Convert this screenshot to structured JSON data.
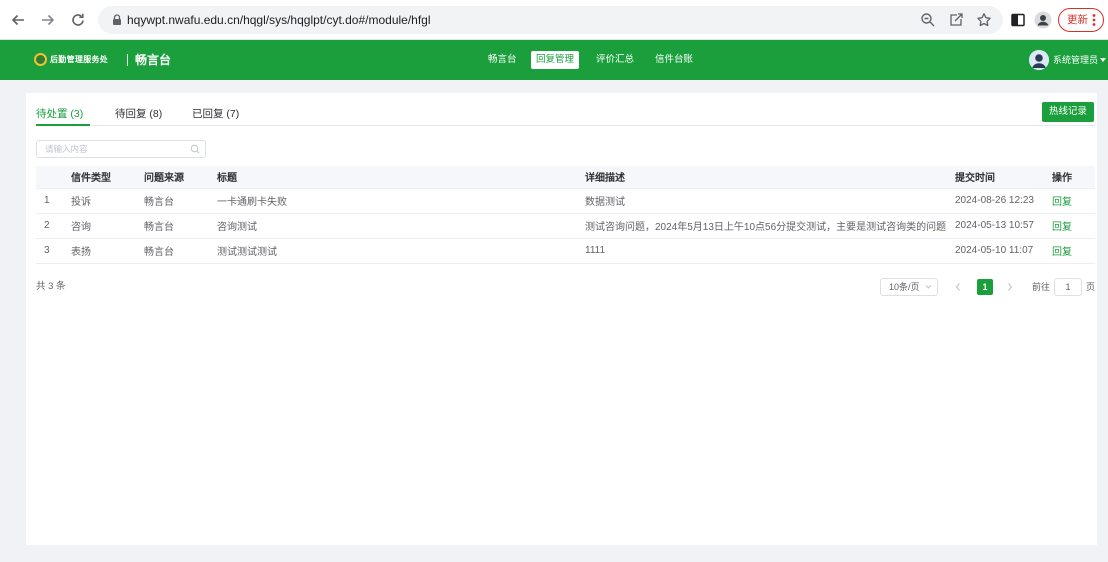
{
  "browser": {
    "url": "hqywpt.nwafu.edu.cn/hqgl/sys/hqglpt/cyt.do#/module/hfgl",
    "update_label": "更新",
    "icons": [
      "back-arrow-icon",
      "forward-arrow-icon",
      "reload-icon",
      "lock-icon",
      "zoom-icon",
      "share-icon",
      "bookmark-star-icon",
      "sidebar-icon",
      "profile-icon",
      "more-menu-icon"
    ]
  },
  "header": {
    "org_name": "后勤管理服务处",
    "app_name": "畅言台",
    "nav": [
      {
        "label": "畅言台",
        "active": false
      },
      {
        "label": "回复管理",
        "active": true
      },
      {
        "label": "评价汇总",
        "active": false
      },
      {
        "label": "信件台账",
        "active": false
      }
    ],
    "user_name": "系统管理员",
    "icons": [
      "emblem-logo",
      "user-avatar-icon",
      "caret-down-icon"
    ]
  },
  "tabs": [
    {
      "label": "待处置 (3)",
      "active": true
    },
    {
      "label": "待回复 (8)",
      "active": false
    },
    {
      "label": "已回复 (7)",
      "active": false
    }
  ],
  "hotline_button_label": "热线记录",
  "search": {
    "placeholder": "请输入内容",
    "value": "",
    "icon": "search-icon"
  },
  "table": {
    "columns": [
      "",
      "信件类型",
      "问题来源",
      "标题",
      "详细描述",
      "提交时间",
      "操作"
    ],
    "rows": [
      {
        "index": "1",
        "type": "投诉",
        "source": "畅言台",
        "title": "一卡通刷卡失败",
        "description": "数据测试",
        "submitted_at": "2024-08-26 12:23",
        "action": "回复"
      },
      {
        "index": "2",
        "type": "咨询",
        "source": "畅言台",
        "title": "咨询测试",
        "description": "测试咨询问题，2024年5月13日上午10点56分提交测试，主要是测试咨询类的问题",
        "submitted_at": "2024-05-13 10:57",
        "action": "回复"
      },
      {
        "index": "3",
        "type": "表扬",
        "source": "畅言台",
        "title": "测试测试测试",
        "description": "1111",
        "submitted_at": "2024-05-10 11:07",
        "action": "回复"
      }
    ]
  },
  "pagination": {
    "total_text": "共 3 条",
    "page_size": "10条/页",
    "current_page": "1",
    "goto_label": "前往",
    "goto_value": "1",
    "goto_unit": "页",
    "icons": [
      "prev-page-icon",
      "next-page-icon"
    ]
  },
  "colors": {
    "brand_green": "#1a9f3c",
    "update_red": "#d93025"
  }
}
